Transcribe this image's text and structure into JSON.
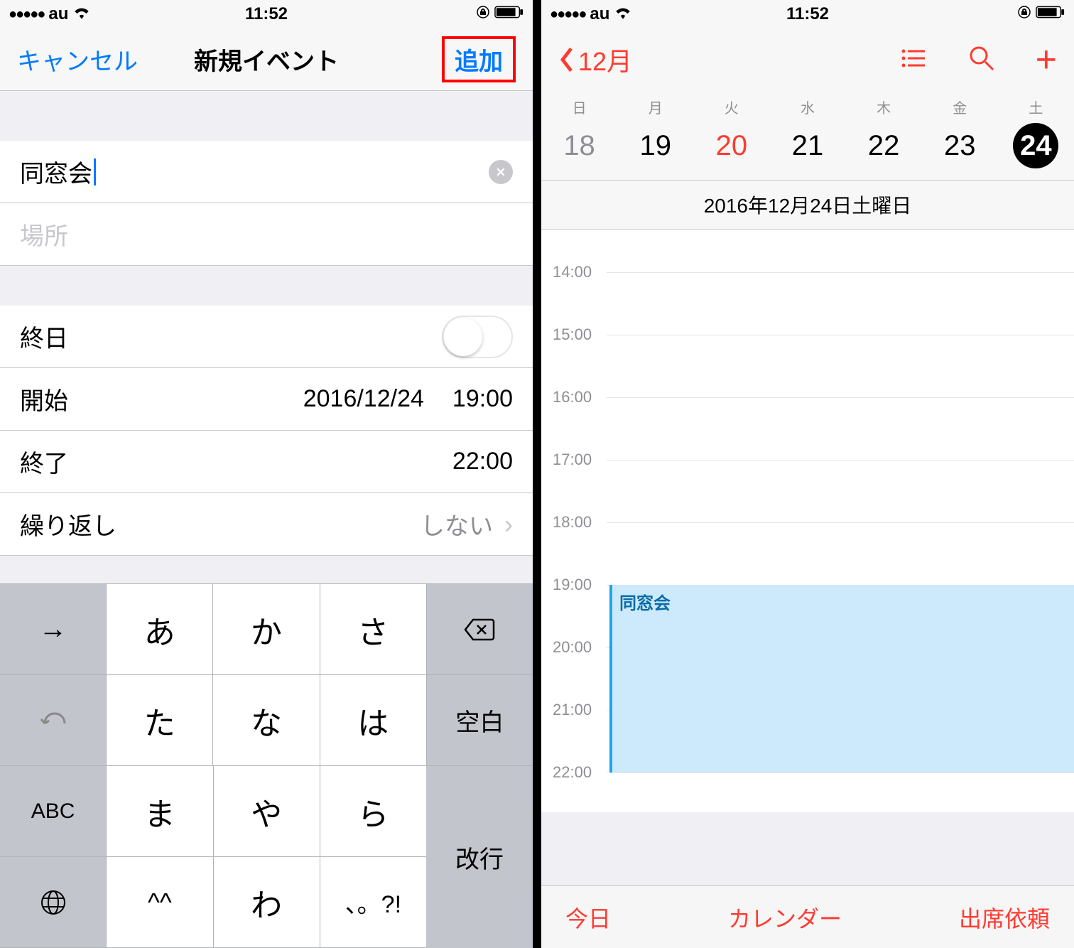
{
  "status": {
    "carrier": "au",
    "time": "11:52"
  },
  "left": {
    "nav": {
      "cancel": "キャンセル",
      "title": "新規イベント",
      "add": "追加"
    },
    "form": {
      "title_value": "同窓会",
      "location_placeholder": "場所",
      "allday_label": "終日",
      "start_label": "開始",
      "start_date": "2016/12/24",
      "start_time": "19:00",
      "end_label": "終了",
      "end_time": "22:00",
      "repeat_label": "繰り返し",
      "repeat_value": "しない"
    },
    "keyboard": {
      "r1": [
        "あ",
        "か",
        "さ"
      ],
      "r2": [
        "た",
        "な",
        "は"
      ],
      "r3": [
        "ま",
        "や",
        "ら"
      ],
      "r4": [
        "^^",
        "わ",
        "、。?!"
      ],
      "space": "空白",
      "enter": "改行",
      "abc": "ABC"
    }
  },
  "right": {
    "back_month": "12月",
    "weekdays": [
      "日",
      "月",
      "火",
      "水",
      "木",
      "金",
      "土"
    ],
    "days": [
      "18",
      "19",
      "20",
      "21",
      "22",
      "23",
      "24"
    ],
    "full_date": "2016年12月24日土曜日",
    "hours": [
      "14:00",
      "15:00",
      "16:00",
      "17:00",
      "18:00",
      "19:00",
      "20:00",
      "21:00",
      "22:00"
    ],
    "event_title": "同窓会",
    "toolbar": {
      "today": "今日",
      "calendars": "カレンダー",
      "inbox": "出席依頼"
    }
  }
}
